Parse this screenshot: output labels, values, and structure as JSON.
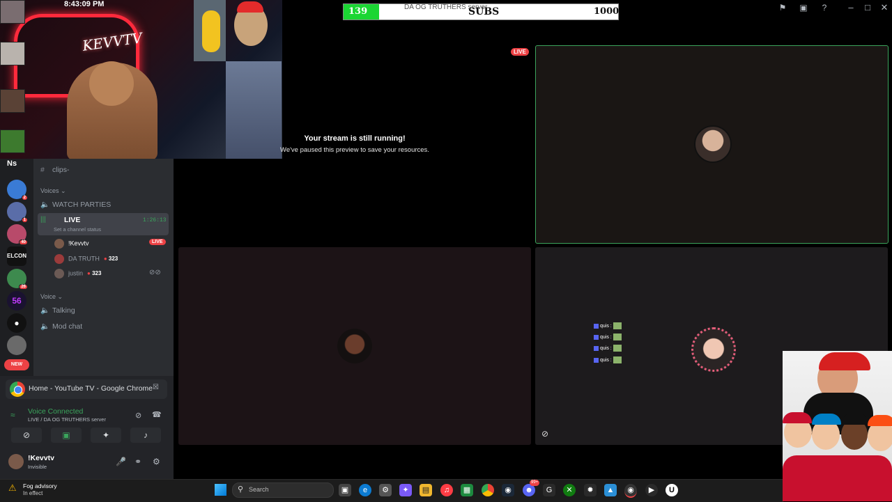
{
  "overlay": {
    "clock": "8:43:09 PM",
    "neon_text": "KEVVTV"
  },
  "sub_goal": {
    "current": "139",
    "label": "SUBS",
    "target": "1000",
    "progress": 0.139,
    "fill_color": "#1bd633",
    "server_title": "DA OG TRUTHERS server"
  },
  "title_bar": {
    "icons": [
      "flag-icon",
      "inbox-icon",
      "help-icon"
    ],
    "window_controls": [
      "minimize-icon",
      "maximize-icon",
      "close-icon"
    ]
  },
  "stage": {
    "live_badge": "LIVE",
    "paused_title": "Your stream is still running!",
    "paused_sub": "We've paused this preview to save your resources.",
    "speaking_border_color": "#3ba55c",
    "quis_rows": [
      "quis :",
      "quis :",
      "quis :",
      "quis :"
    ]
  },
  "guilds": {
    "top_label": "Ns",
    "badges": [
      "2",
      "1",
      "40",
      "",
      "26",
      "",
      "",
      ""
    ],
    "text_server": "ELCON",
    "num_server": "56",
    "new_badge": "NEW"
  },
  "channels": {
    "text_channel": "clips-",
    "category_voices": "Voices",
    "watch_parties": "WATCH PARTIES",
    "live_channel": "LIVE",
    "live_timer": "1:26:13",
    "live_status": "Set a channel status",
    "members": [
      {
        "name": "!Kevvtv",
        "badge": "LIVE"
      },
      {
        "name": "DA TRUTH",
        "score": "323"
      },
      {
        "name": "justin",
        "score": "323"
      }
    ],
    "category_voice": "Voice",
    "talking": "Talking",
    "mod_chat": "Mod chat"
  },
  "share": {
    "title": "Home - YouTube TV - Google Chrome"
  },
  "voice_panel": {
    "title": "Voice Connected",
    "sub": "LIVE / DA OG TRUTHERS server"
  },
  "user": {
    "name": "!Kevvtv",
    "status": "Invisible"
  },
  "taskbar": {
    "weather_title": "Fog advisory",
    "weather_sub": "In effect",
    "search_placeholder": "Search",
    "chat_badge": "99+"
  },
  "colors": {
    "discord_bg": "#2b2d31",
    "accent_live": "#ed4245",
    "voice_green": "#3ba55c"
  }
}
